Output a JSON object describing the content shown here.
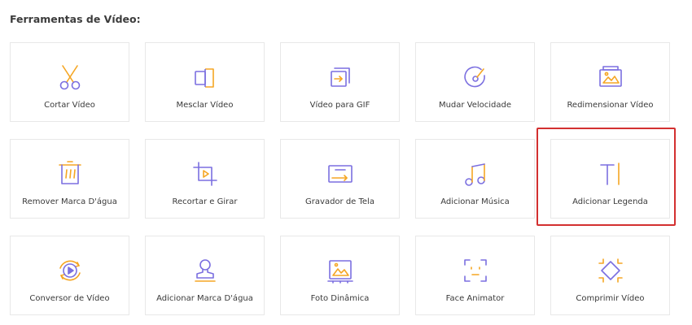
{
  "section": {
    "title": "Ferramentas de Vídeo:"
  },
  "colors": {
    "purple": "#7b6fe0",
    "orange": "#f5a623",
    "highlight": "#d33030"
  },
  "tools": [
    {
      "label": "Cortar Vídeo",
      "icon": "scissors-icon"
    },
    {
      "label": "Mesclar Vídeo",
      "icon": "merge-icon"
    },
    {
      "label": "Vídeo para GIF",
      "icon": "gif-export-icon"
    },
    {
      "label": "Mudar Velocidade",
      "icon": "speedometer-icon"
    },
    {
      "label": "Redimensionar Vídeo",
      "icon": "resize-image-icon"
    },
    {
      "label": "Remover Marca D'água",
      "icon": "trash-watermark-icon"
    },
    {
      "label": "Recortar e Girar",
      "icon": "crop-rotate-icon"
    },
    {
      "label": "Gravador de Tela",
      "icon": "screen-recorder-icon"
    },
    {
      "label": "Adicionar Música",
      "icon": "music-note-icon"
    },
    {
      "label": "Adicionar Legenda",
      "icon": "text-cursor-icon"
    },
    {
      "label": "Conversor de Vídeo",
      "icon": "convert-play-icon"
    },
    {
      "label": "Adicionar Marca D'água",
      "icon": "user-stamp-icon"
    },
    {
      "label": "Foto Dinâmica",
      "icon": "dynamic-photo-icon"
    },
    {
      "label": "Face Animator",
      "icon": "face-frame-icon"
    },
    {
      "label": "Comprimir Vídeo",
      "icon": "compress-icon"
    }
  ]
}
